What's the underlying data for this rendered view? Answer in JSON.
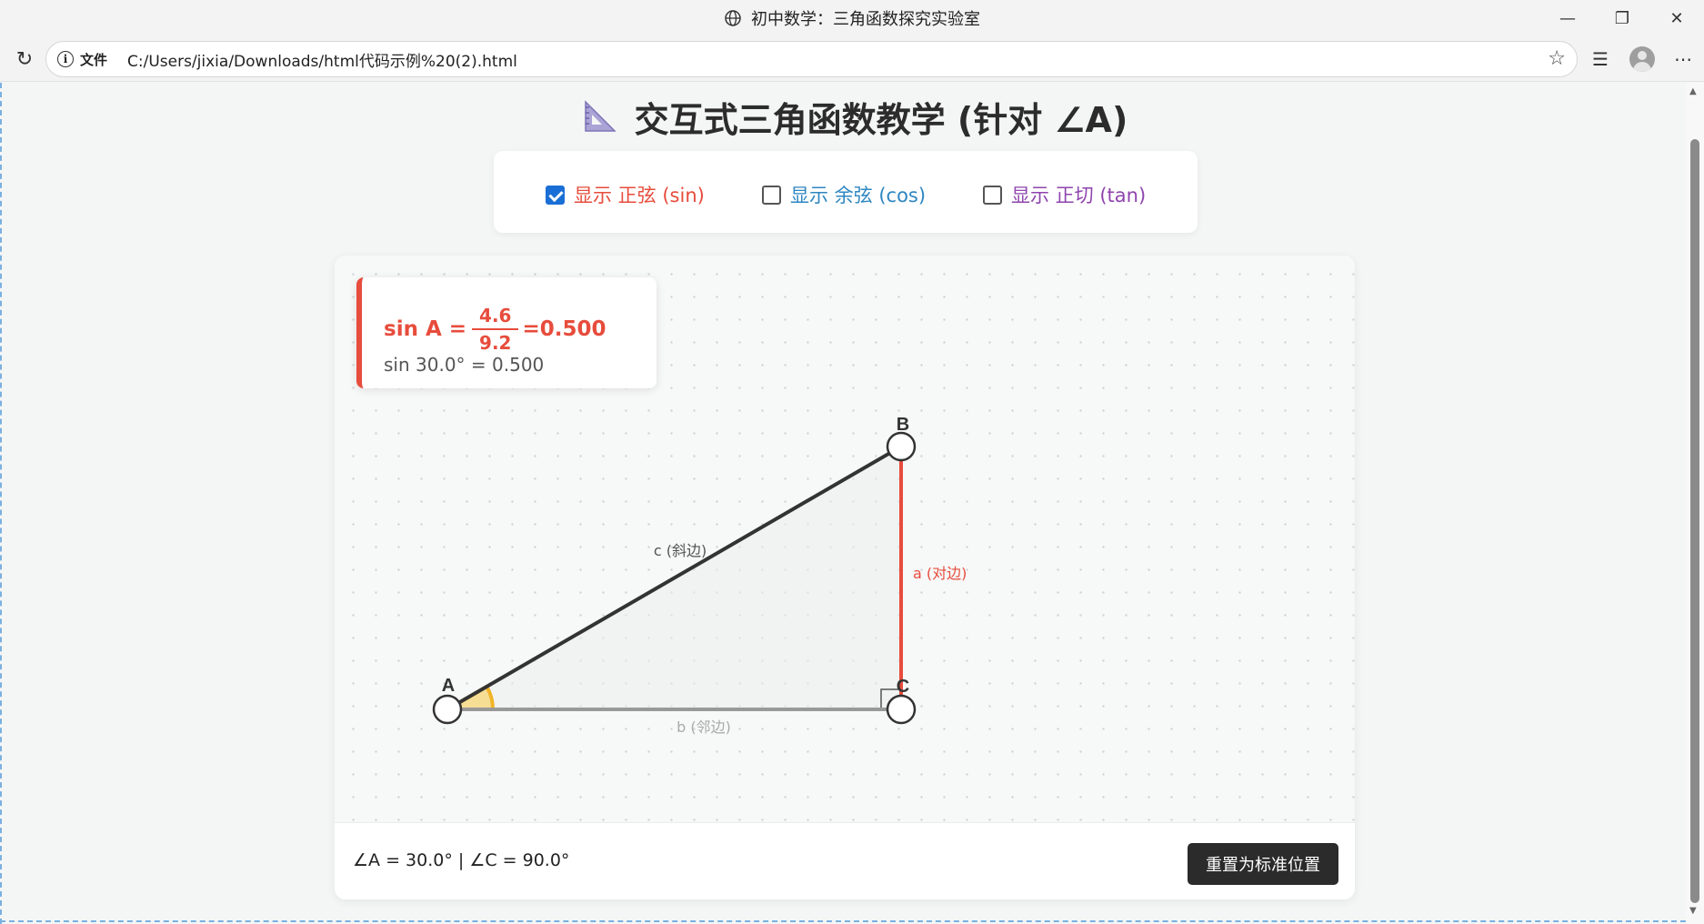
{
  "browser": {
    "tab_title": "初中数学：三角函数探究实验室",
    "file_label": "文件",
    "url": "C:/Users/jixia/Downloads/html代码示例%20(2).html"
  },
  "heading": {
    "icon": "triangular-ruler-icon",
    "title": "交互式三角函数教学 (针对 ∠A)"
  },
  "controls": [
    {
      "label": "显示 正弦 (sin)",
      "checked": true,
      "color": "#e74c3c"
    },
    {
      "label": "显示 余弦 (cos)",
      "checked": false,
      "color": "#2e86c1"
    },
    {
      "label": "显示 正切 (tan)",
      "checked": false,
      "color": "#8e44ad"
    }
  ],
  "formula": {
    "prefix": "sin A =",
    "numerator": "4.6",
    "denominator": "9.2",
    "result": "=0.500",
    "value_line": "sin 30.0° = 0.500",
    "color": "#e74c3c"
  },
  "triangle": {
    "vertices": {
      "A": "A",
      "B": "B",
      "C": "C"
    },
    "side_labels": {
      "hypotenuse": "c (斜边)",
      "opposite": "a (对边)",
      "adjacent": "b (邻边)"
    },
    "colors": {
      "hypotenuse": "#333333",
      "opposite": "#e74c3c",
      "adjacent": "#999999",
      "angle_mark": "#f0b429"
    }
  },
  "footer": {
    "angles_text": "∠A = 30.0° | ∠C = 90.0°",
    "reset_label": "重置为标准位置"
  }
}
